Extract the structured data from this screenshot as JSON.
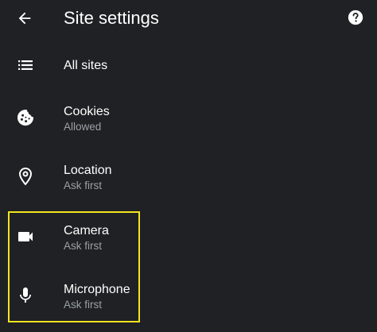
{
  "header": {
    "title": "Site settings"
  },
  "items": [
    {
      "label": "All sites",
      "icon": "list-icon"
    },
    {
      "label": "Cookies",
      "sub": "Allowed",
      "icon": "cookie-icon"
    },
    {
      "label": "Location",
      "sub": "Ask first",
      "icon": "location-pin-icon"
    },
    {
      "label": "Camera",
      "sub": "Ask first",
      "icon": "videocam-icon"
    },
    {
      "label": "Microphone",
      "sub": "Ask first",
      "icon": "microphone-icon"
    }
  ],
  "colors": {
    "background": "#202124",
    "text": "#ffffff",
    "secondary_text": "#9aa0a6",
    "highlight": "#f2e51f"
  }
}
